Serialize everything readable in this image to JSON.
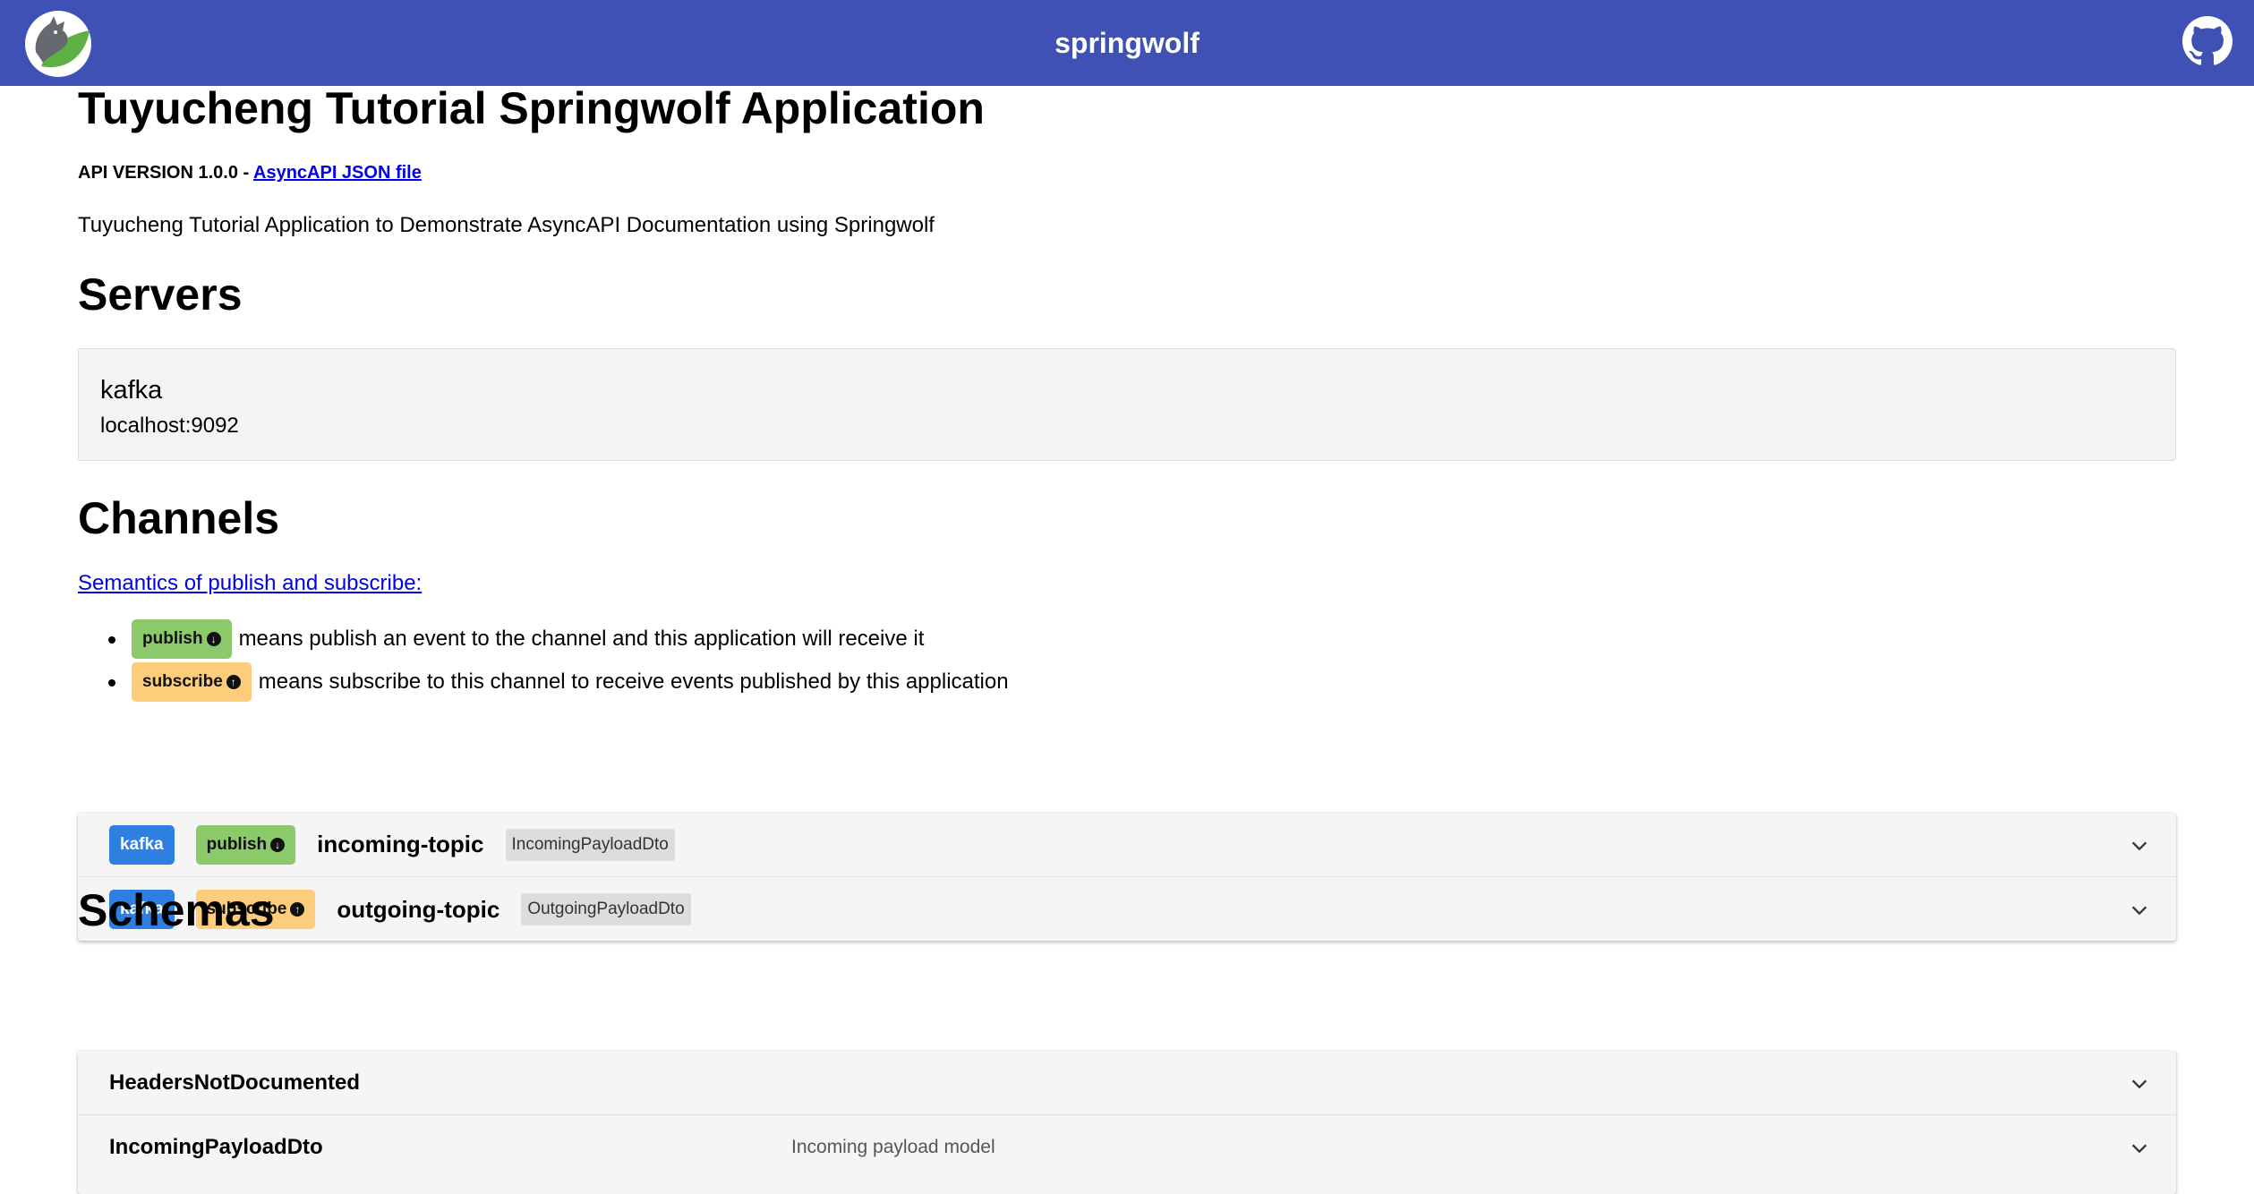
{
  "header": {
    "title": "springwolf",
    "logo_icon": "springwolf-logo-icon",
    "github_icon": "github-icon"
  },
  "info": {
    "title": "Tuyucheng Tutorial Springwolf Application",
    "version_label": "API VERSION 1.0.0 - ",
    "json_link": "AsyncAPI JSON file",
    "description": "Tuyucheng Tutorial Application to Demonstrate AsyncAPI Documentation using Springwolf"
  },
  "servers": {
    "heading": "Servers",
    "items": [
      {
        "name": "kafka",
        "url": "localhost:9092"
      }
    ]
  },
  "channels": {
    "heading": "Channels",
    "semantics_link": "Semantics of publish and subscribe:",
    "semantics": [
      {
        "badge": "publish",
        "text": "means publish an event to the channel and this application will receive it"
      },
      {
        "badge": "subscribe",
        "text": "means subscribe to this channel to receive events published by this application"
      }
    ],
    "items": [
      {
        "protocol": "kafka",
        "operation": "publish",
        "name": "incoming-topic",
        "payload": "IncomingPayloadDto"
      },
      {
        "protocol": "kafka",
        "operation": "subscribe",
        "name": "outgoing-topic",
        "payload": "OutgoingPayloadDto"
      }
    ]
  },
  "schemas": {
    "heading": "Schemas",
    "items": [
      {
        "name": "HeadersNotDocumented",
        "description": ""
      },
      {
        "name": "IncomingPayloadDto",
        "description": "Incoming payload model"
      }
    ]
  },
  "colors": {
    "header_bg": "#3f51b5",
    "publish": "#8bc96a",
    "subscribe": "#fdcd7c",
    "kafka": "#2f7ee2"
  }
}
